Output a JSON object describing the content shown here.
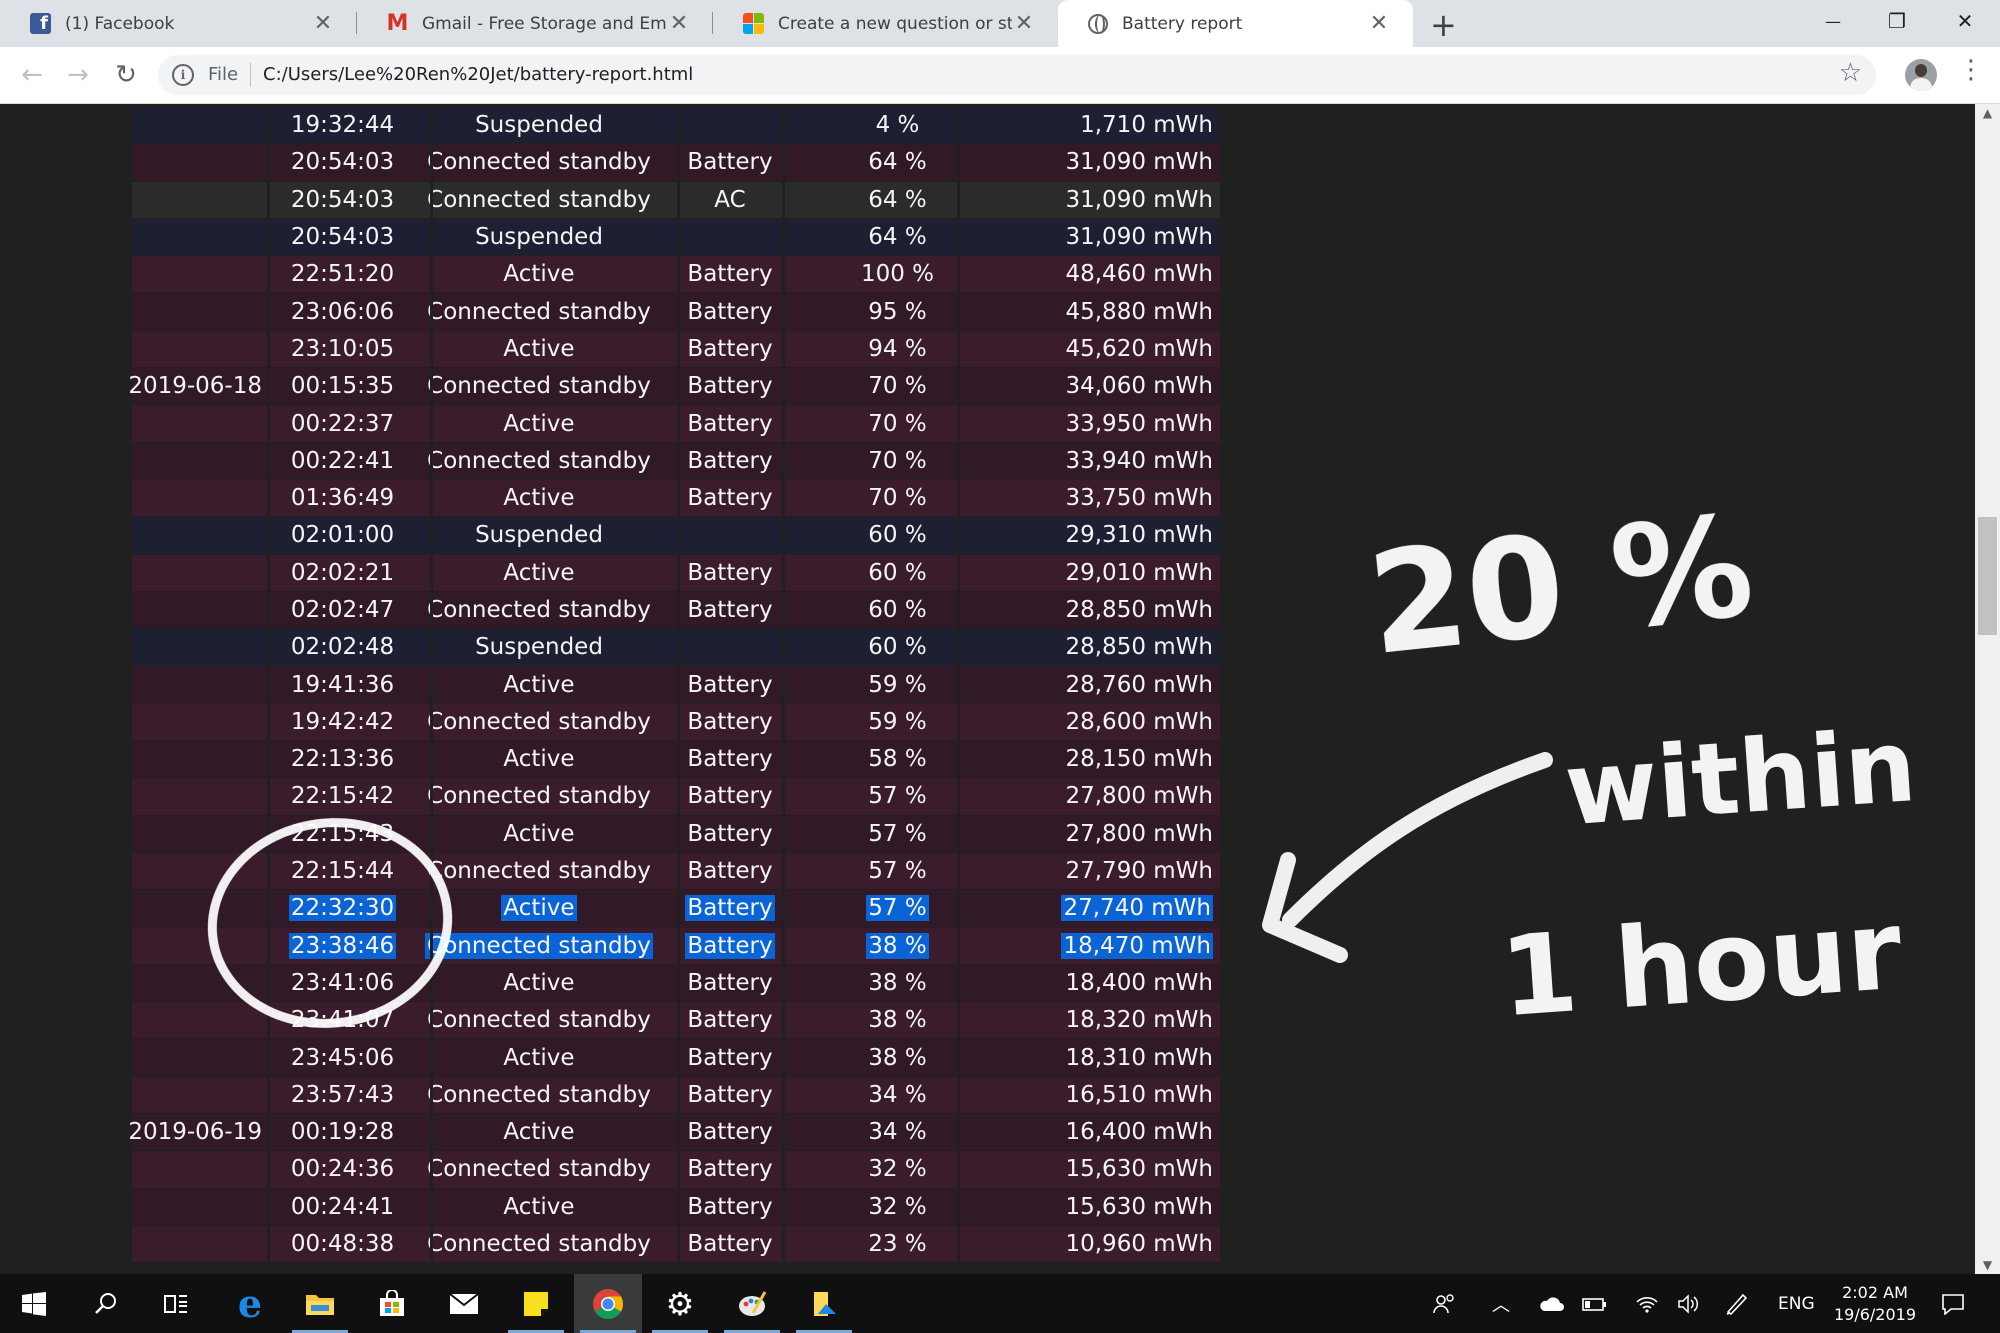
{
  "browser": {
    "tabs": [
      {
        "title": "(1) Facebook",
        "icon": "facebook-icon",
        "active": false
      },
      {
        "title": "Gmail - Free Storage and Email from Google",
        "icon": "gmail-icon",
        "active": false
      },
      {
        "title": "Create a new question or start a discussion",
        "icon": "microsoft-icon",
        "active": false
      },
      {
        "title": "Battery report",
        "icon": "globe-icon",
        "active": true
      }
    ],
    "close_glyph": "✕",
    "new_tab_glyph": "+",
    "window_controls": {
      "minimize": "—",
      "restore": "❐",
      "close": "✕"
    },
    "toolbar": {
      "back": "←",
      "forward": "→",
      "reload": "↻",
      "info_glyph": "i",
      "scheme_label": "File",
      "url": "C:/Users/Lee%20Ren%20Jet/battery-report.html",
      "star": "☆",
      "menu": "⋮"
    }
  },
  "report": {
    "rows": [
      {
        "date": "",
        "time": "19:32:44",
        "state": "Suspended",
        "source": "",
        "percent": "4 %",
        "capacity": "1,710 mWh",
        "kind": "sus"
      },
      {
        "date": "",
        "time": "20:54:03",
        "state": "Connected standby",
        "source": "Battery",
        "percent": "64 %",
        "capacity": "31,090 mWh",
        "kind": "bat"
      },
      {
        "date": "",
        "time": "20:54:03",
        "state": "Connected standby",
        "source": "AC",
        "percent": "64 %",
        "capacity": "31,090 mWh",
        "kind": "ac"
      },
      {
        "date": "",
        "time": "20:54:03",
        "state": "Suspended",
        "source": "",
        "percent": "64 %",
        "capacity": "31,090 mWh",
        "kind": "sus"
      },
      {
        "date": "",
        "time": "22:51:20",
        "state": "Active",
        "source": "Battery",
        "percent": "100 %",
        "capacity": "48,460 mWh",
        "kind": "bat"
      },
      {
        "date": "",
        "time": "23:06:06",
        "state": "Connected standby",
        "source": "Battery",
        "percent": "95 %",
        "capacity": "45,880 mWh",
        "kind": "bat"
      },
      {
        "date": "",
        "time": "23:10:05",
        "state": "Active",
        "source": "Battery",
        "percent": "94 %",
        "capacity": "45,620 mWh",
        "kind": "bat"
      },
      {
        "date": "2019-06-18",
        "time": "00:15:35",
        "state": "Connected standby",
        "source": "Battery",
        "percent": "70 %",
        "capacity": "34,060 mWh",
        "kind": "bat"
      },
      {
        "date": "",
        "time": "00:22:37",
        "state": "Active",
        "source": "Battery",
        "percent": "70 %",
        "capacity": "33,950 mWh",
        "kind": "bat"
      },
      {
        "date": "",
        "time": "00:22:41",
        "state": "Connected standby",
        "source": "Battery",
        "percent": "70 %",
        "capacity": "33,940 mWh",
        "kind": "bat"
      },
      {
        "date": "",
        "time": "01:36:49",
        "state": "Active",
        "source": "Battery",
        "percent": "70 %",
        "capacity": "33,750 mWh",
        "kind": "bat"
      },
      {
        "date": "",
        "time": "02:01:00",
        "state": "Suspended",
        "source": "",
        "percent": "60 %",
        "capacity": "29,310 mWh",
        "kind": "sus"
      },
      {
        "date": "",
        "time": "02:02:21",
        "state": "Active",
        "source": "Battery",
        "percent": "60 %",
        "capacity": "29,010 mWh",
        "kind": "bat"
      },
      {
        "date": "",
        "time": "02:02:47",
        "state": "Connected standby",
        "source": "Battery",
        "percent": "60 %",
        "capacity": "28,850 mWh",
        "kind": "bat"
      },
      {
        "date": "",
        "time": "02:02:48",
        "state": "Suspended",
        "source": "",
        "percent": "60 %",
        "capacity": "28,850 mWh",
        "kind": "sus"
      },
      {
        "date": "",
        "time": "19:41:36",
        "state": "Active",
        "source": "Battery",
        "percent": "59 %",
        "capacity": "28,760 mWh",
        "kind": "bat"
      },
      {
        "date": "",
        "time": "19:42:42",
        "state": "Connected standby",
        "source": "Battery",
        "percent": "59 %",
        "capacity": "28,600 mWh",
        "kind": "bat"
      },
      {
        "date": "",
        "time": "22:13:36",
        "state": "Active",
        "source": "Battery",
        "percent": "58 %",
        "capacity": "28,150 mWh",
        "kind": "bat"
      },
      {
        "date": "",
        "time": "22:15:42",
        "state": "Connected standby",
        "source": "Battery",
        "percent": "57 %",
        "capacity": "27,800 mWh",
        "kind": "bat"
      },
      {
        "date": "",
        "time": "22:15:43",
        "state": "Active",
        "source": "Battery",
        "percent": "57 %",
        "capacity": "27,800 mWh",
        "kind": "bat"
      },
      {
        "date": "",
        "time": "22:15:44",
        "state": "Connected standby",
        "source": "Battery",
        "percent": "57 %",
        "capacity": "27,790 mWh",
        "kind": "bat"
      },
      {
        "date": "",
        "time": "22:32:30",
        "state": "Active",
        "source": "Battery",
        "percent": "57 %",
        "capacity": "27,740 mWh",
        "kind": "bat",
        "selected": true
      },
      {
        "date": "",
        "time": "23:38:46",
        "state": "Connected standby",
        "source": "Battery",
        "percent": "38 %",
        "capacity": "18,470 mWh",
        "kind": "bat",
        "selected": true
      },
      {
        "date": "",
        "time": "23:41:06",
        "state": "Active",
        "source": "Battery",
        "percent": "38 %",
        "capacity": "18,400 mWh",
        "kind": "bat"
      },
      {
        "date": "",
        "time": "23:41:07",
        "state": "Connected standby",
        "source": "Battery",
        "percent": "38 %",
        "capacity": "18,320 mWh",
        "kind": "bat"
      },
      {
        "date": "",
        "time": "23:45:06",
        "state": "Active",
        "source": "Battery",
        "percent": "38 %",
        "capacity": "18,310 mWh",
        "kind": "bat"
      },
      {
        "date": "",
        "time": "23:57:43",
        "state": "Connected standby",
        "source": "Battery",
        "percent": "34 %",
        "capacity": "16,510 mWh",
        "kind": "bat"
      },
      {
        "date": "2019-06-19",
        "time": "00:19:28",
        "state": "Active",
        "source": "Battery",
        "percent": "34 %",
        "capacity": "16,400 mWh",
        "kind": "bat"
      },
      {
        "date": "",
        "time": "00:24:36",
        "state": "Connected standby",
        "source": "Battery",
        "percent": "32 %",
        "capacity": "15,630 mWh",
        "kind": "bat"
      },
      {
        "date": "",
        "time": "00:24:41",
        "state": "Active",
        "source": "Battery",
        "percent": "32 %",
        "capacity": "15,630 mWh",
        "kind": "bat"
      },
      {
        "date": "",
        "time": "00:48:38",
        "state": "Connected standby",
        "source": "Battery",
        "percent": "23 %",
        "capacity": "10,960 mWh",
        "kind": "bat"
      }
    ],
    "colors": {
      "battery_row": "#3b1c2c",
      "suspended_row": "#1d1f33",
      "ac_row": "#2b2b2b",
      "selection": "#0a64d6"
    }
  },
  "annotation": {
    "line1": "20 %",
    "line2": "within",
    "line3": "1 hour",
    "color": "#ffffff"
  },
  "taskbar": {
    "apps": [
      {
        "name": "start-icon"
      },
      {
        "name": "search-icon"
      },
      {
        "name": "task-view-icon"
      },
      {
        "name": "edge-icon"
      },
      {
        "name": "file-explorer-icon"
      },
      {
        "name": "store-icon"
      },
      {
        "name": "mail-icon"
      },
      {
        "name": "sticky-notes-icon"
      },
      {
        "name": "chrome-icon"
      },
      {
        "name": "settings-icon"
      },
      {
        "name": "paint-icon"
      },
      {
        "name": "photos-icon"
      }
    ],
    "tray": {
      "language": "ENG",
      "time": "2:02 AM",
      "date": "19/6/2019"
    }
  }
}
